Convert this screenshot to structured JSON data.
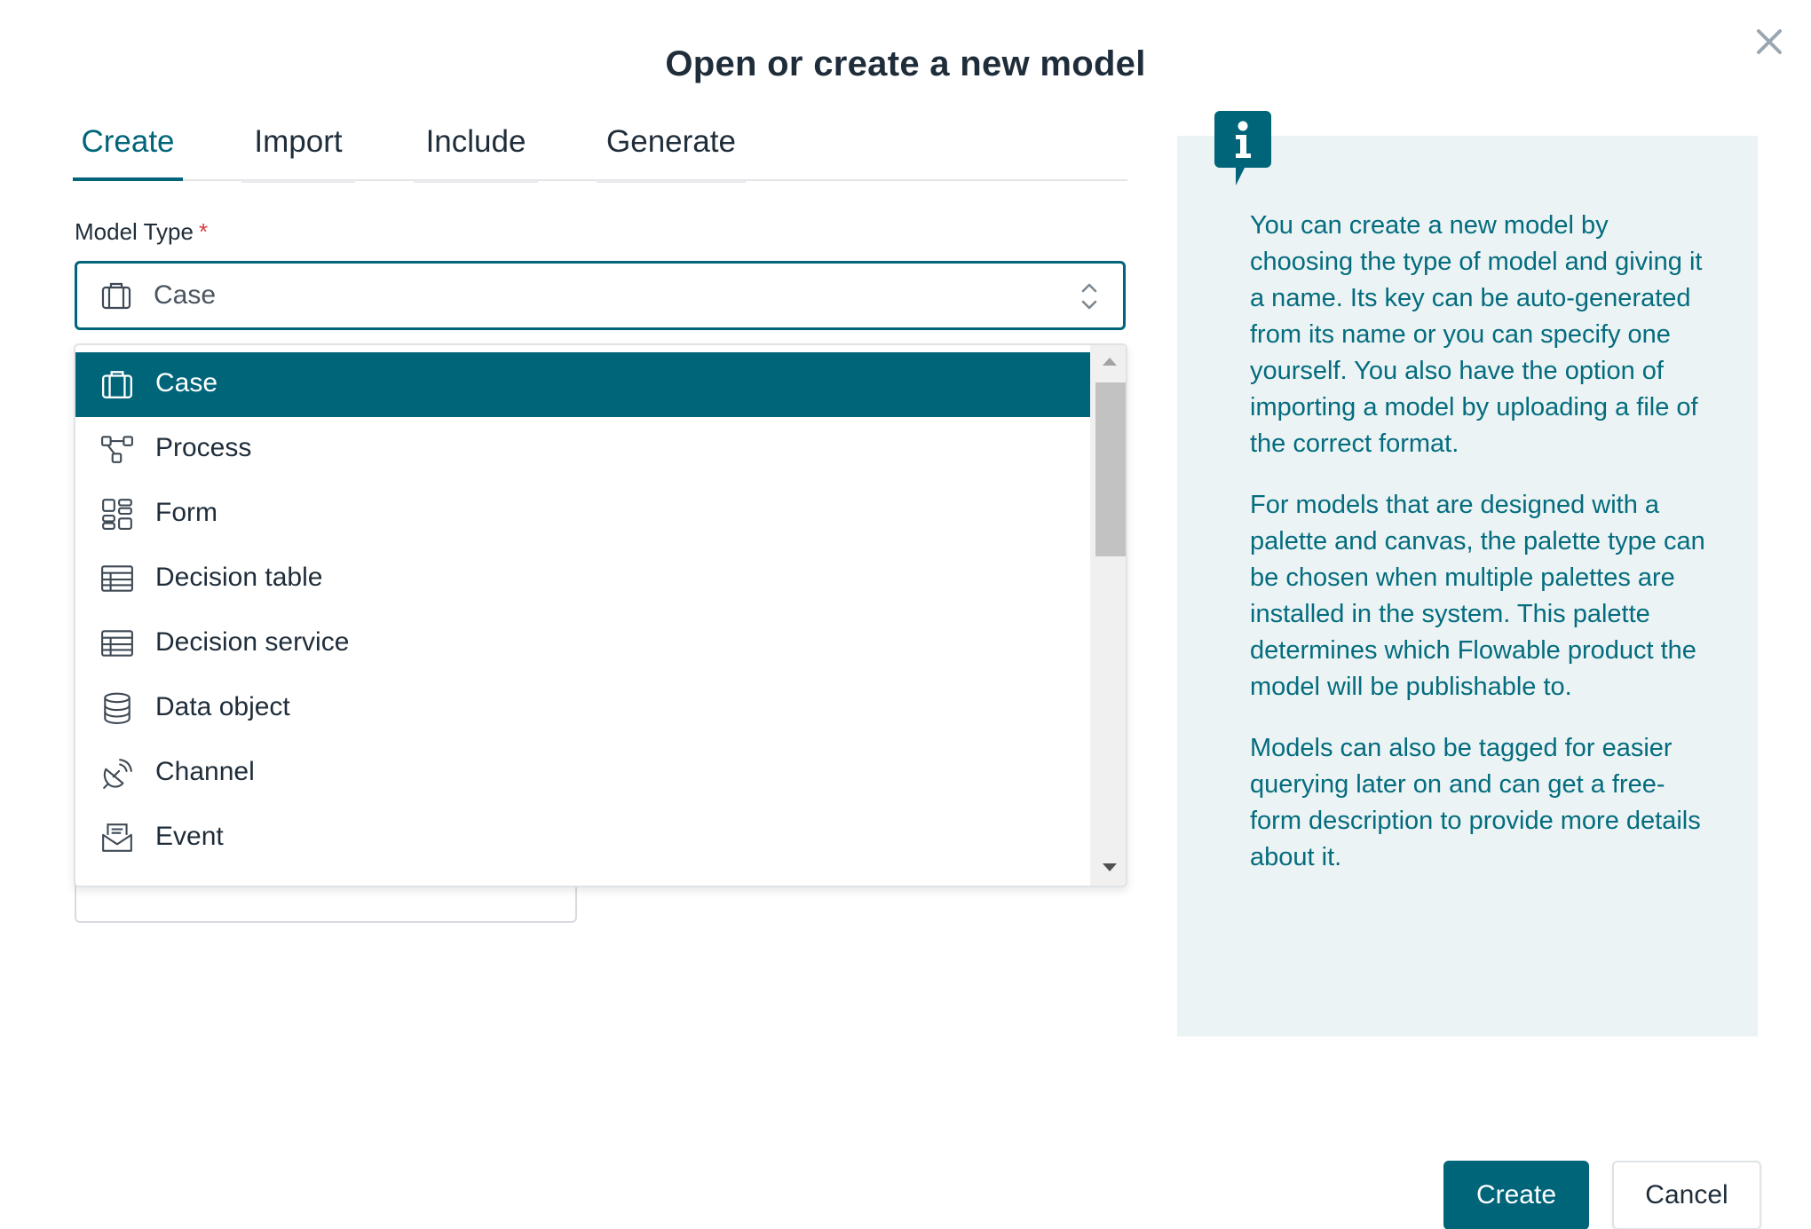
{
  "dialog": {
    "title": "Open or create a new model",
    "close_icon": "close-icon"
  },
  "tabs": [
    {
      "label": "Create",
      "active": true
    },
    {
      "label": "Import",
      "active": false
    },
    {
      "label": "Include",
      "active": false
    },
    {
      "label": "Generate",
      "active": false
    }
  ],
  "model_type": {
    "label": "Model Type",
    "required_marker": "*",
    "selected_value": "Case",
    "selected_icon": "briefcase-icon",
    "arrows_icon": "sort-arrows-icon"
  },
  "dropdown": {
    "options": [
      {
        "label": "Case",
        "icon": "briefcase-icon",
        "selected": true
      },
      {
        "label": "Process",
        "icon": "process-flow-icon",
        "selected": false
      },
      {
        "label": "Form",
        "icon": "form-icon",
        "selected": false
      },
      {
        "label": "Decision table",
        "icon": "table-icon",
        "selected": false
      },
      {
        "label": "Decision service",
        "icon": "table-icon",
        "selected": false
      },
      {
        "label": "Data object",
        "icon": "database-icon",
        "selected": false
      },
      {
        "label": "Channel",
        "icon": "satellite-icon",
        "selected": false
      },
      {
        "label": "Event",
        "icon": "inbox-mail-icon",
        "selected": false
      }
    ]
  },
  "info": {
    "badge_icon": "info-icon",
    "paragraphs": [
      "You can create a new model by choosing the type of model and giving it a name. Its key can be auto-generated from its name or you can specify one yourself. You also have the option of importing a model by uploading a file of the correct format.",
      "For models that are designed with a palette and canvas, the palette type can be chosen when multiple palettes are installed in the system. This palette determines which Flowable product the model will be publishable to.",
      "Models can also be tagged for easier querying later on and can get a free-form description to provide more details about it."
    ]
  },
  "footer": {
    "create_label": "Create",
    "cancel_label": "Cancel"
  },
  "colors": {
    "accent": "#01657a",
    "info_bg": "#ebf3f4",
    "info_text": "#046c7e",
    "required": "#d63e3e"
  }
}
